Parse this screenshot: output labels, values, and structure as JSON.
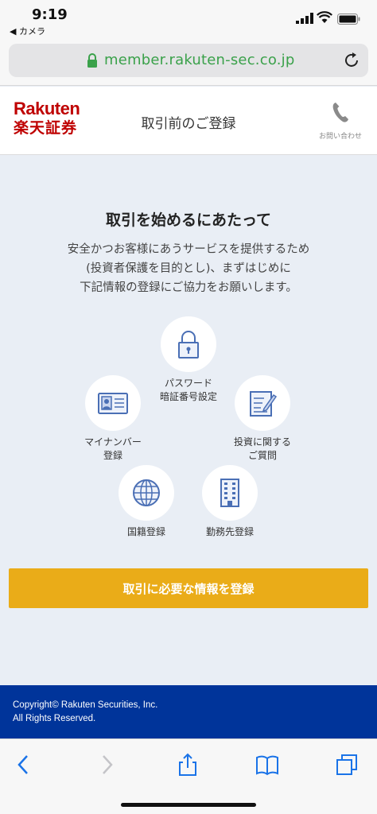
{
  "status": {
    "time": "9:19",
    "back_label": "◀ カメラ"
  },
  "browser": {
    "url": "member.rakuten-sec.co.jp"
  },
  "header": {
    "logo_en": "Rakuten",
    "logo_jp": "楽天証券",
    "title": "取引前のご登録",
    "contact_label": "お問い合わせ"
  },
  "main": {
    "heading": "取引を始めるにあたって",
    "description_lines": [
      "安全かつお客様にあうサービスを提供するため",
      "(投資者保護を目的とし)、まずはじめに",
      "下記情報の登録にご協力をお願いします。"
    ],
    "steps": [
      {
        "icon": "lock-icon",
        "label_lines": [
          "パスワード",
          "暗証番号設定"
        ]
      },
      {
        "icon": "id-card-icon",
        "label_lines": [
          "マイナンバー",
          "登録"
        ]
      },
      {
        "icon": "document-pen-icon",
        "label_lines": [
          "投資に関する",
          "ご質問"
        ]
      },
      {
        "icon": "globe-icon",
        "label_lines": [
          "国籍登録"
        ]
      },
      {
        "icon": "building-icon",
        "label_lines": [
          "勤務先登録"
        ]
      }
    ],
    "cta_label": "取引に必要な情報を登録"
  },
  "footer": {
    "copyright_line1": "Copyright© Rakuten Securities, Inc.",
    "copyright_line2": "All Rights Reserved."
  },
  "colors": {
    "brand_red": "#bf0000",
    "cta_yellow": "#eaac18",
    "footer_blue": "#00349a",
    "icon_blue": "#4a6fb5",
    "url_green": "#3aa14a"
  }
}
